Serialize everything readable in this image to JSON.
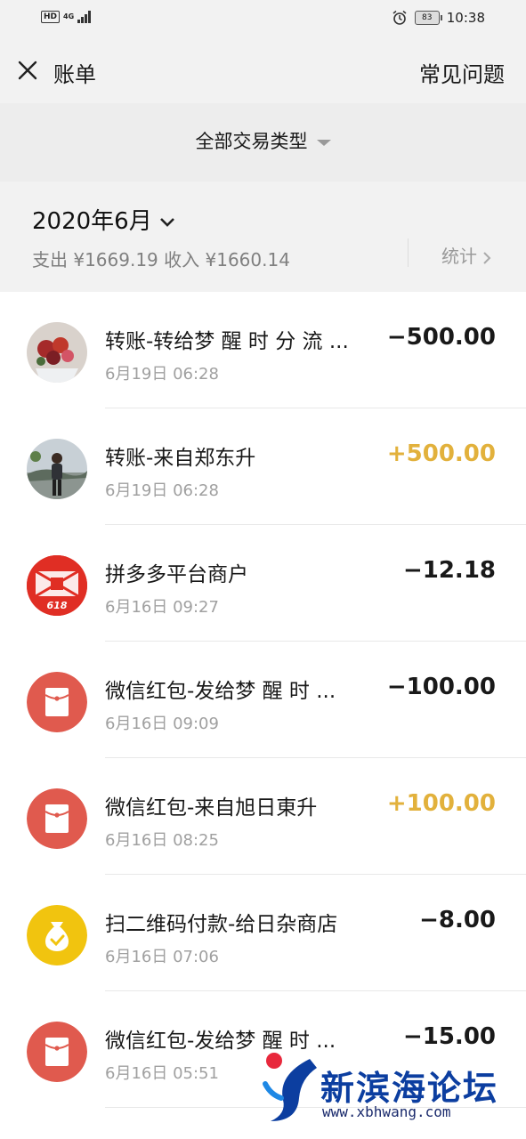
{
  "status_bar": {
    "hd": "HD",
    "network": "4G",
    "battery": "83",
    "time": "10:38"
  },
  "header": {
    "title": "账单",
    "faq": "常见问题",
    "close_icon": "close-icon"
  },
  "filter": {
    "label": "全部交易类型"
  },
  "month_section": {
    "month": "2020年6月",
    "summary": "支出 ¥1669.19 收入 ¥1660.14",
    "stats_label": "统计"
  },
  "colors": {
    "income": "#e2b13c",
    "red_packet": "#e05a4e",
    "qr_payment": "#f1c40f"
  },
  "transactions": [
    {
      "name": "转账-转给梦 醒 时 分 流 ...",
      "time": "6月19日 06:28",
      "amount": "−500.00",
      "avatar": "flowers-photo"
    },
    {
      "name": "转账-来自郑东升",
      "time": "6月19日 06:28",
      "amount": "+500.00",
      "avatar": "person-photo"
    },
    {
      "name": "拼多多平台商户",
      "time": "6月16日 09:27",
      "amount": "−12.18",
      "avatar": "pinduoduo-logo",
      "avatar_text": "618"
    },
    {
      "name": "微信红包-发给梦 醒 时 ...",
      "time": "6月16日 09:09",
      "amount": "−100.00",
      "avatar": "red-packet-icon"
    },
    {
      "name": "微信红包-来自旭日東升",
      "time": "6月16日 08:25",
      "amount": "+100.00",
      "avatar": "red-packet-icon"
    },
    {
      "name": "扫二维码付款-给日杂商店",
      "time": "6月16日 07:06",
      "amount": "−8.00",
      "avatar": "money-bag-icon"
    },
    {
      "name": "微信红包-发给梦 醒 时 ...",
      "time": "6月16日 05:51",
      "amount": "−15.00",
      "avatar": "red-packet-icon"
    }
  ],
  "watermark": {
    "text": "新滨海论坛",
    "url": "www.xbhwang.com"
  }
}
